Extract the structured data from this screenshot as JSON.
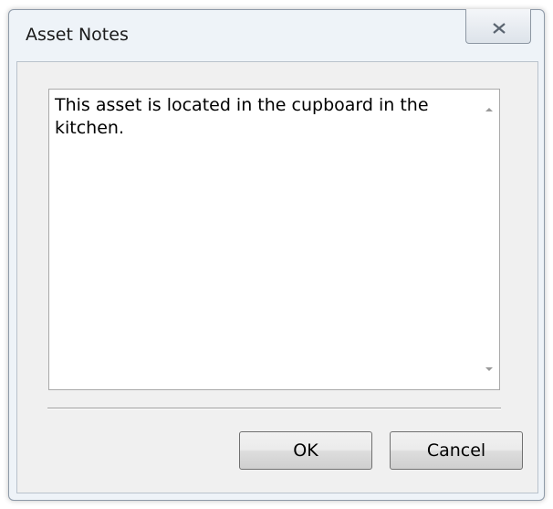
{
  "window": {
    "title": "Asset Notes"
  },
  "notes": {
    "text": "This asset is located in the cupboard in the kitchen."
  },
  "buttons": {
    "ok_label": "OK",
    "cancel_label": "Cancel"
  },
  "icons": {
    "close": "close-icon",
    "scroll_up": "scroll-up-arrow-icon",
    "scroll_down": "scroll-down-arrow-icon"
  },
  "colors": {
    "window_frame": "#eef3f8",
    "panel_background": "#f0f0f0",
    "text": "#000000"
  }
}
